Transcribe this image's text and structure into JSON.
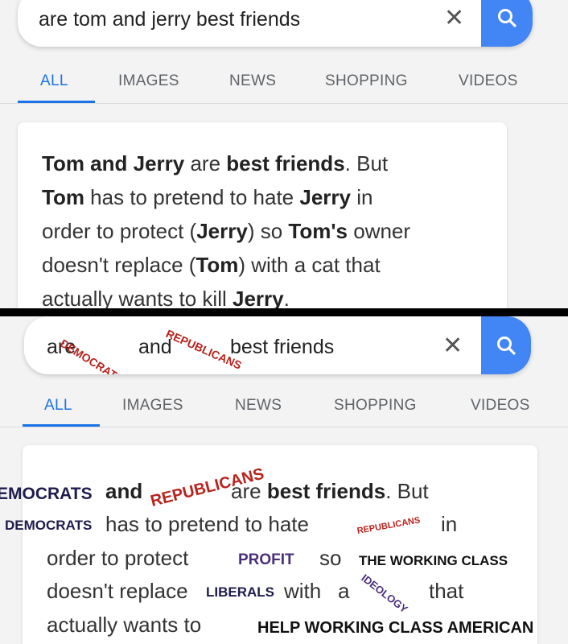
{
  "top": {
    "search": {
      "query": "are tom and jerry best friends",
      "clear_icon": "close-icon",
      "search_icon": "search-icon"
    },
    "tabs": [
      "ALL",
      "IMAGES",
      "NEWS",
      "SHOPPING",
      "VIDEOS"
    ],
    "active_tab": "ALL",
    "snippet": {
      "l1_a": "Tom and Jerry",
      "l1_b": " are ",
      "l1_c": "best friends",
      "l1_d": ". But",
      "l2_a": "Tom",
      "l2_b": " has to pretend to hate ",
      "l2_c": "Jerry",
      "l2_d": " in",
      "l3_a": "order to protect (",
      "l3_b": "Jerry",
      "l3_c": ") so ",
      "l3_d": "Tom's",
      "l3_e": " owner",
      "l4_a": "doesn't replace (",
      "l4_b": "Tom",
      "l4_c": ") with a cat that",
      "l5_a": "actually wants to kill ",
      "l5_b": "Jerry",
      "l5_c": "."
    }
  },
  "bottom": {
    "search": {
      "q_are": "are",
      "q_and": "and",
      "q_rest": "best friends",
      "scrawl_democrats": "Democrats",
      "scrawl_republicans": "Republicans"
    },
    "tabs": [
      "ALL",
      "IMAGES",
      "NEWS",
      "SHOPPING",
      "VIDEOS"
    ],
    "active_tab": "ALL",
    "snippet": {
      "l1_scrawl_democrats": "EMOCRATS",
      "l1_and": "and",
      "l1_scrawl_republicans": "REPUBLICANS",
      "l1_are": "are ",
      "l1_best": "best friends",
      "l1_but": ". But",
      "l2_scrawl_democrats": "DEMOCRATS",
      "l2_text": "has to pretend to hate",
      "l2_scrawl_republicans": "REPUBLICANS",
      "l2_in": "in",
      "l3_text": "order to protect",
      "l3_profit": "PROFIT",
      "l3_so": "so",
      "l3_working": "THE WORKING CLASS",
      "l4_text": "doesn't replace",
      "l4_liberals": "LIBERALS",
      "l4_with": "with",
      "l4_a": "a",
      "l4_ideology": "IDEOLOGY",
      "l4_that": "that",
      "l5_text": "actually wants to",
      "l5_help": "HELP WORKING CLASS AMERICAN"
    }
  },
  "colors": {
    "accent_blue": "#1a73e8",
    "search_button": "#4285f4",
    "scrawl_red": "#b8231c",
    "scrawl_navy": "#1f1c4e",
    "scrawl_purple": "#4a2e7a"
  }
}
